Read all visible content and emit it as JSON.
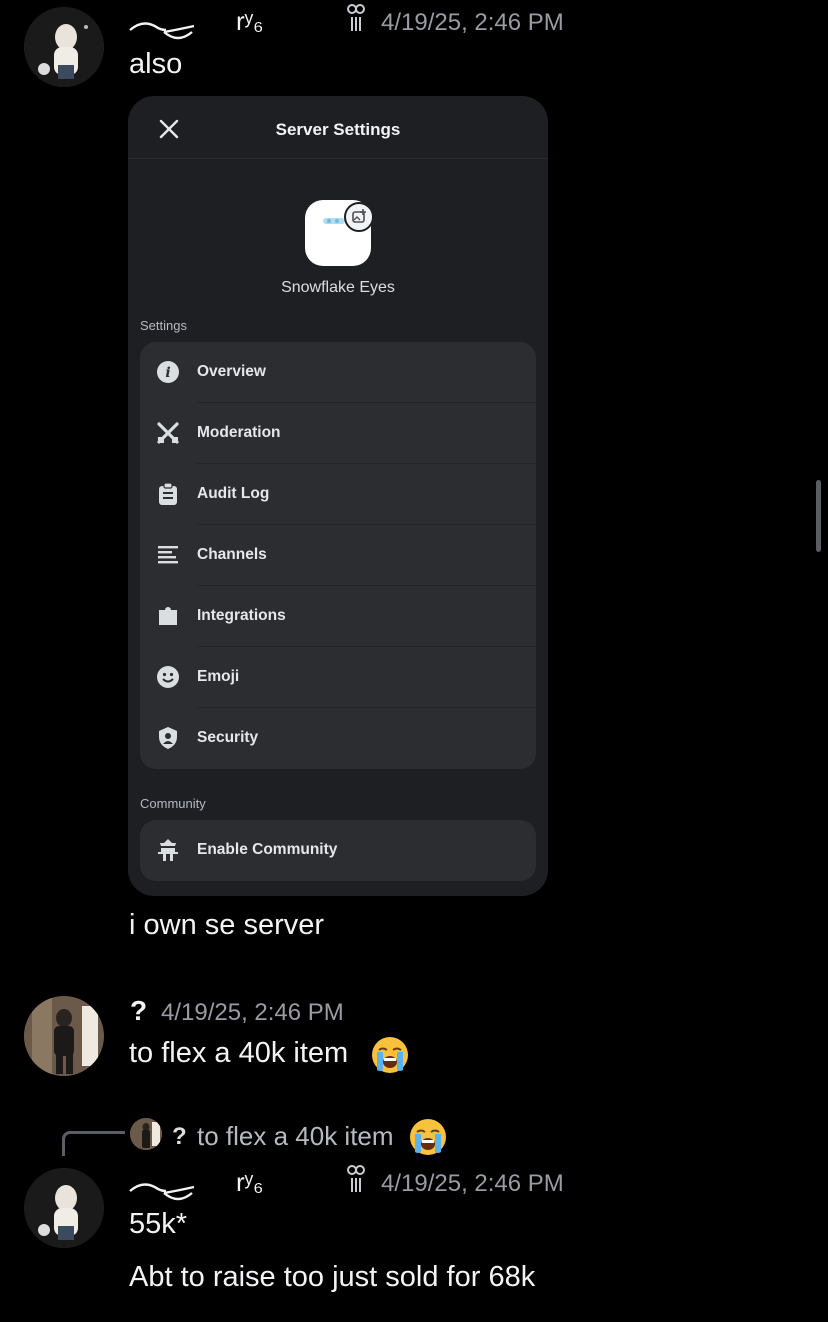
{
  "messages": [
    {
      "username": "⁀⊹",
      "username_extra": "rʸ₆",
      "badge_icon": "pretzel-badge-icon",
      "timestamp": "4/19/25, 2:46 PM",
      "text": "also"
    },
    {
      "text": "i own se server"
    },
    {
      "username": "?",
      "timestamp": "4/19/25, 2:46 PM",
      "text": "to flex a 40k item",
      "emoji": "loudly-crying-face-emoji"
    },
    {
      "reply_to": {
        "username": "?",
        "text": "to flex a 40k item",
        "emoji": "loudly-crying-face-emoji"
      },
      "username": "⁀⊹",
      "username_extra": "rʸ₆",
      "badge_icon": "pretzel-badge-icon",
      "timestamp": "4/19/25, 2:46 PM",
      "text": "55k*"
    },
    {
      "text": "Abt to raise too just sold for 68k"
    }
  ],
  "embedded_screenshot": {
    "title": "Server Settings",
    "server_name": "Snowflake Eyes",
    "sections": [
      {
        "label": "Settings",
        "items": [
          {
            "label": "Overview",
            "icon": "info-icon"
          },
          {
            "label": "Moderation",
            "icon": "swords-icon"
          },
          {
            "label": "Audit Log",
            "icon": "clipboard-icon"
          },
          {
            "label": "Channels",
            "icon": "text-lines-icon"
          },
          {
            "label": "Integrations",
            "icon": "puzzle-icon"
          },
          {
            "label": "Emoji",
            "icon": "smiley-icon"
          },
          {
            "label": "Security",
            "icon": "shield-icon"
          }
        ]
      },
      {
        "label": "Community",
        "items": [
          {
            "label": "Enable Community",
            "icon": "community-icon"
          }
        ]
      }
    ]
  }
}
